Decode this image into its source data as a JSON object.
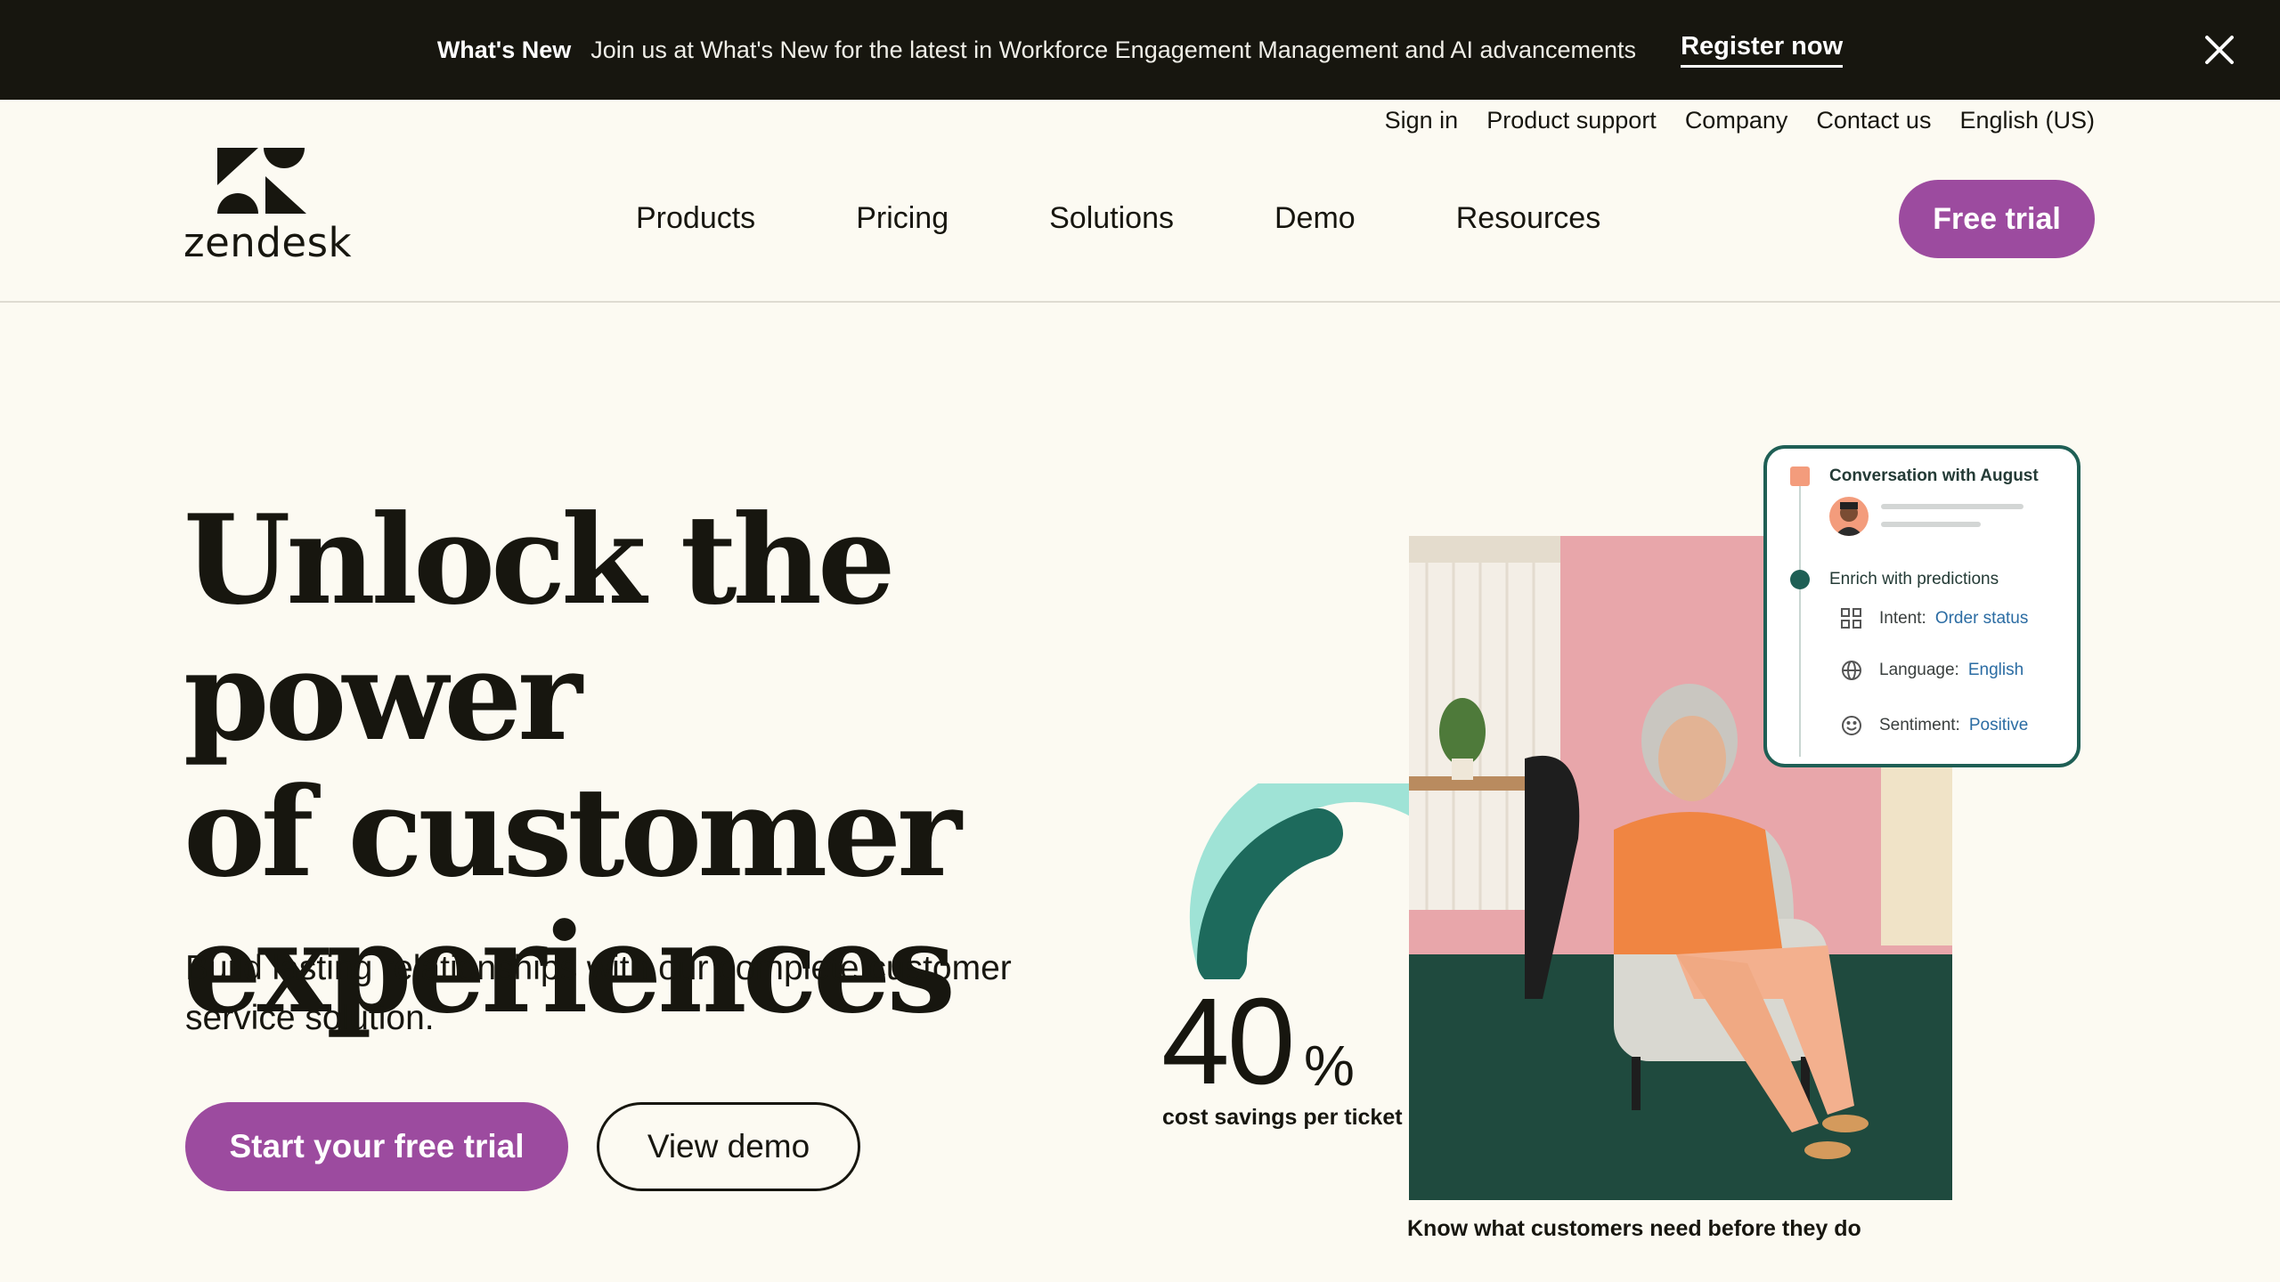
{
  "announcement": {
    "label": "What's New",
    "message": "Join us at What's New for the latest in Workforce Engagement Management and AI advancements",
    "link": "Register now",
    "close_icon": "close-icon"
  },
  "utility_nav": {
    "items": [
      "Sign in",
      "Product support",
      "Company",
      "Contact us",
      "English (US)"
    ]
  },
  "brand": {
    "wordmark": "zendesk",
    "logo_icon": "zendesk-z-logo"
  },
  "main_nav": {
    "items": [
      "Products",
      "Pricing",
      "Solutions",
      "Demo",
      "Resources"
    ],
    "cta": "Free trial"
  },
  "hero": {
    "title_lines": [
      "Unlock the power",
      "of customer",
      "experiences"
    ],
    "subtitle": "Build lasting relationships with our complete customer service solution.",
    "primary_cta": "Start your free trial",
    "secondary_cta": "View demo"
  },
  "stat": {
    "value": "40",
    "unit": "%",
    "label": "cost savings per ticket"
  },
  "photo": {
    "caption": "Know what customers need before they do"
  },
  "conversation_card": {
    "title": "Conversation with August",
    "enrich": "Enrich with predictions",
    "rows": [
      {
        "icon": "grid-icon",
        "label": "Intent:",
        "value": "Order status"
      },
      {
        "icon": "globe-icon",
        "label": "Language:",
        "value": "English"
      },
      {
        "icon": "smile-icon",
        "label": "Sentiment:",
        "value": "Positive"
      }
    ]
  },
  "colors": {
    "announcement_bg": "#17160f",
    "page_bg": "#fcfaf2",
    "brand_purple": "#9c4b9f",
    "arc_dark": "#1d6a5c",
    "arc_light": "#9fe3d6",
    "card_border": "#1f5f55",
    "link_blue": "#2b6ca3"
  }
}
